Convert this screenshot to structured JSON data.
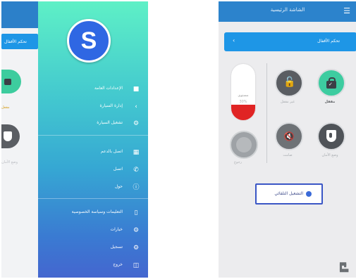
{
  "left_screen": {
    "behind": {
      "card_label": "تحکم الأقفال",
      "lock_label": "مقفل",
      "shield_label": "وضع الأمان"
    },
    "drawer": {
      "avatar_letter": "S",
      "menu_groups": [
        [
          {
            "label": "الإعدادات العامة",
            "icon": "home-icon"
          },
          {
            "label": "إدارة السيارة",
            "icon": "car-icon"
          },
          {
            "label": "تشغيل السيارة",
            "icon": "settings-icon"
          }
        ],
        [
          {
            "label": "اتصل بالدعم",
            "icon": "grid-icon"
          },
          {
            "label": "اتصل",
            "icon": "phone-icon"
          },
          {
            "label": "حول",
            "icon": "info-icon"
          }
        ],
        [
          {
            "label": "التعليمات وسياسة الخصوصية",
            "icon": "document-icon"
          },
          {
            "label": "خيارات",
            "icon": "settings-icon"
          },
          {
            "label": "تسجيل",
            "icon": "settings-icon"
          },
          {
            "label": "خروج",
            "icon": "exit-icon"
          }
        ]
      ]
    }
  },
  "right_screen": {
    "title": "الشاشة الرئيسية",
    "menu_icon": "menu-icon",
    "card_label": "تحكم الأقفال",
    "volume": {
      "label": "مستوى",
      "value": "30%",
      "fraction": 0.28
    },
    "knob_label": "رجوع",
    "controls": {
      "lock_open_label": "غير مقفل",
      "lock_closed_label": "مقفل",
      "mute_label": "صامت",
      "shield_label": "وضع الأمان"
    },
    "auto_button_label": "التشغيل التلقائي",
    "colors": {
      "topbar": "#2c83cc",
      "card": "#1e96e6",
      "green": "#3dcca0",
      "gray_control": "#5a5d62",
      "volume_fill": "#e02424",
      "button_border": "#3a56c5"
    }
  }
}
